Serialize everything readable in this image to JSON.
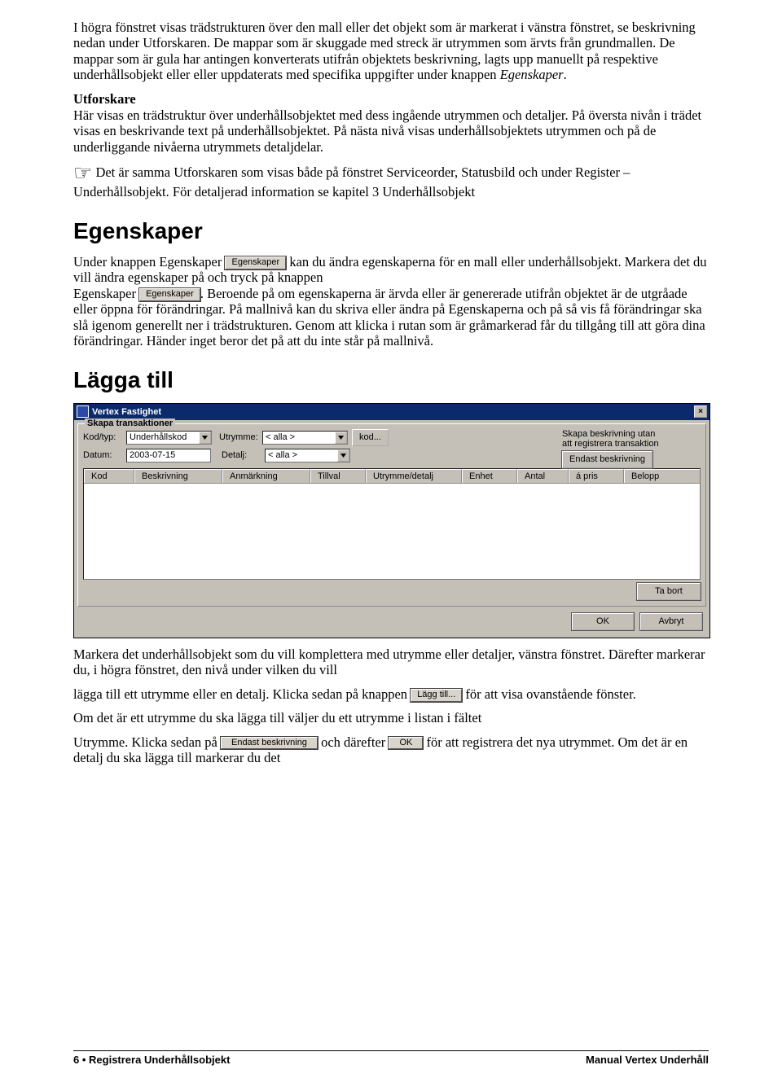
{
  "para1": "I högra fönstret visas trädstrukturen över den mall eller det objekt som är markerat i vänstra fönstret, se beskrivning nedan under Utforskaren. De mappar som är skuggade med streck är utrymmen som ärvts från grundmallen. De mappar som är gula har antingen konverterats utifrån objektets beskrivning, lagts upp manuellt på respektive underhållsobjekt eller eller uppdaterats med specifika uppgifter under knappen",
  "para1_em": "Egenskaper",
  "utf_head": "Utforskare",
  "utf_body": "Här visas en trädstruktur över underhållsobjektet med dess ingående utrymmen och detaljer. På översta nivån i trädet visas en beskrivande text på underhållsobjektet. På nästa nivå visas underhållsobjektets utrymmen och på de underliggande nivåerna utrymmets detaljdelar.",
  "note": "Det är samma Utforskaren som visas både på fönstret Serviceorder, Statusbild och under Register – Underhållsobjekt. För detaljerad information se kapitel 3 Underhållsobjekt",
  "h_eg": "Egenskaper",
  "eg_1a": "Under knappen Egenskaper",
  "eg_1b": "kan du ändra egenskaperna för en mall eller underhållsobjekt. Markera det du vill ändra egenskaper på och tryck på knappen",
  "eg_2a": "Egenskaper",
  "eg_2b": ". Beroende på om egenskaperna är ärvda eller är genererade utifrån objektet är de utgråade eller öppna för förändringar. På mallnivå kan du skriva eller ändra på Egenskaperna och på så vis få förändringar ska slå igenom generellt ner i trädstrukturen. Genom att klicka i rutan som är gråmarkerad får du tillgång till att göra dina förändringar. Händer inget beror det på att du inte står på mallnivå.",
  "btn_egenskaper": "Egenskaper",
  "h_lagg": "Lägga till",
  "win": {
    "title": "Vertex Fastighet",
    "group_legend": "Skapa transaktioner",
    "lbl_kod": "Kod/typ:",
    "val_kod": "Underhållskod",
    "lbl_utr": "Utrymme:",
    "val_alla": "< alla >",
    "btn_kod": "kod...",
    "lbl_datum": "Datum:",
    "val_datum": "2003-07-15",
    "lbl_detalj": "Detalj:",
    "note1": "Skapa beskrivning utan",
    "note2": "att registrera transaktion",
    "btn_endast": "Endast beskrivning",
    "cols": [
      "Kod",
      "Beskrivning",
      "Anmärkning",
      "Tillval",
      "Utrymme/detalj",
      "Enhet",
      "Antal",
      "á pris",
      "Belopp"
    ],
    "btn_tabort": "Ta bort",
    "btn_ok": "OK",
    "btn_avbryt": "Avbryt"
  },
  "after1": "Markera det underhållsobjekt som du vill komplettera med utrymme eller detaljer, vänstra fönstret. Därefter markerar du, i högra fönstret, den nivå under vilken du vill",
  "after2a": "lägga till ett utrymme eller en detalj. Klicka sedan på knappen",
  "btn_laggtill": "Lägg till...",
  "after2b": "för att visa ovanstående fönster.",
  "after3": "Om det är ett utrymme du ska lägga till väljer du ett utrymme i listan i fältet",
  "after4a": "Utrymme. Klicka sedan på",
  "btn_eb2": "Endast beskrivning",
  "after4b": "och därefter",
  "btn_ok2": "OK",
  "after4c": "för att registrera det nya utrymmet. Om det är en detalj du ska lägga till markerar du det",
  "footer_left_a": "6  ",
  "footer_left_b": "  Registrera Underhållsobjekt",
  "footer_right": "Manual Vertex Underhåll"
}
